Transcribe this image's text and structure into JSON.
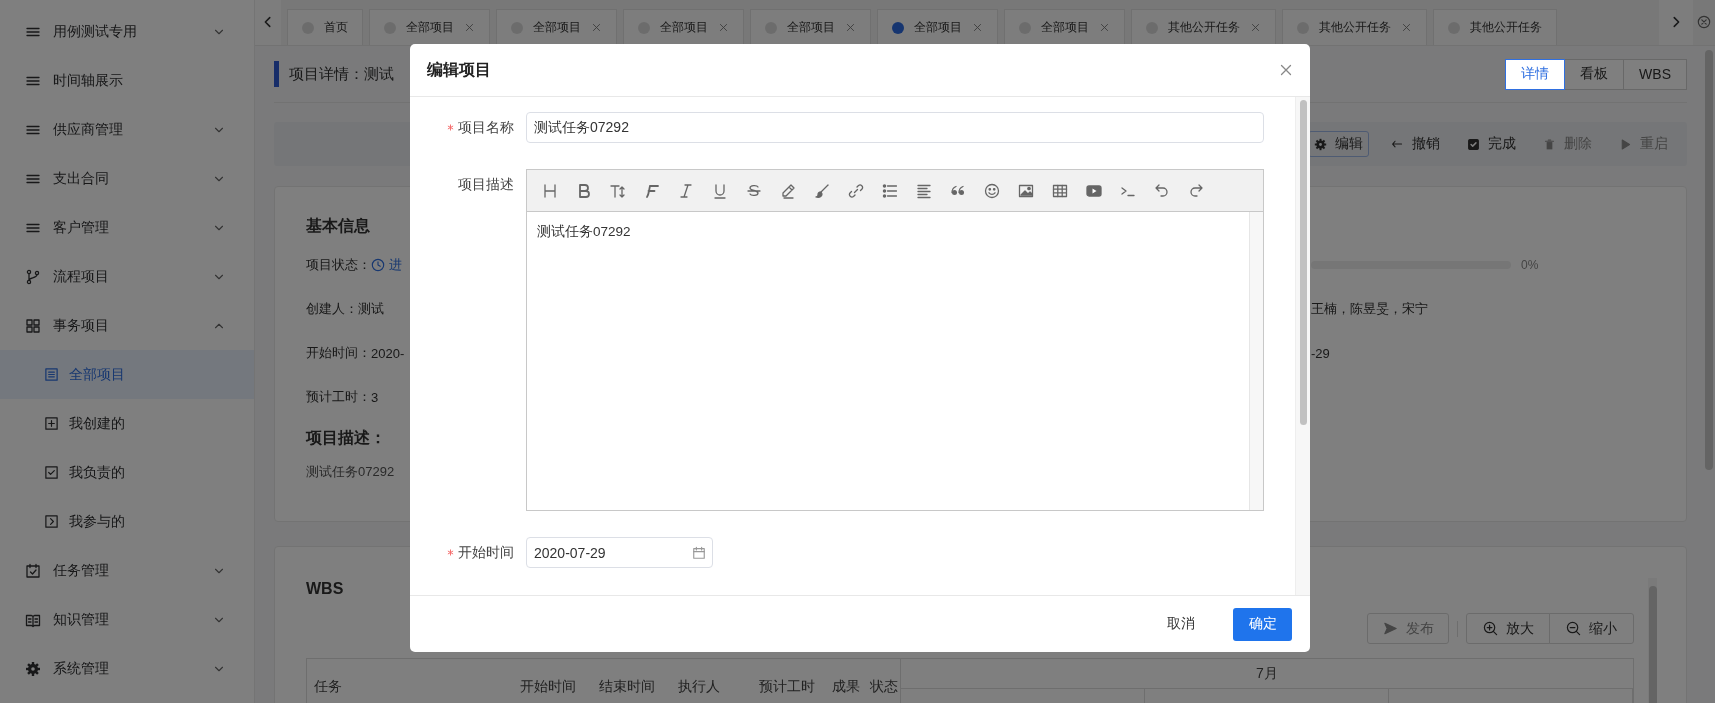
{
  "sidebar": {
    "items": [
      {
        "label": "用例测试专用",
        "kind": "group",
        "expanded": false,
        "selected": false
      },
      {
        "label": "时间轴展示",
        "kind": "link",
        "selected": false
      },
      {
        "label": "供应商管理",
        "kind": "group",
        "expanded": false,
        "selected": false
      },
      {
        "label": "支出合同",
        "kind": "group",
        "expanded": false,
        "selected": false
      },
      {
        "label": "客户管理",
        "kind": "group",
        "expanded": false,
        "selected": false
      },
      {
        "label": "流程项目",
        "kind": "group",
        "expanded": false,
        "selected": false
      },
      {
        "label": "事务项目",
        "kind": "group",
        "expanded": true,
        "selected": false,
        "children": [
          {
            "label": "全部项目",
            "selected": true
          },
          {
            "label": "我创建的",
            "selected": false
          },
          {
            "label": "我负责的",
            "selected": false
          },
          {
            "label": "我参与的",
            "selected": false
          }
        ]
      },
      {
        "label": "任务管理",
        "kind": "group",
        "expanded": false,
        "selected": false
      },
      {
        "label": "知识管理",
        "kind": "group",
        "expanded": false,
        "selected": false
      },
      {
        "label": "系统管理",
        "kind": "group",
        "expanded": false,
        "selected": false
      }
    ]
  },
  "tabs": [
    {
      "label": "首页",
      "selected": false,
      "closable": false
    },
    {
      "label": "全部项目",
      "selected": false,
      "closable": true
    },
    {
      "label": "全部项目",
      "selected": false,
      "closable": true
    },
    {
      "label": "全部项目",
      "selected": false,
      "closable": true
    },
    {
      "label": "全部项目",
      "selected": false,
      "closable": true
    },
    {
      "label": "全部项目",
      "selected": true,
      "closable": true
    },
    {
      "label": "全部项目",
      "selected": false,
      "closable": true
    },
    {
      "label": "其他公开任务",
      "selected": false,
      "closable": true
    },
    {
      "label": "其他公开任务",
      "selected": false,
      "closable": true
    },
    {
      "label": "其他公开任务",
      "selected": false,
      "closable": false
    }
  ],
  "page": {
    "title": "项目详情：测试",
    "view_tabs": [
      {
        "label": "详情",
        "selected": true
      },
      {
        "label": "看板",
        "selected": false
      },
      {
        "label": "WBS",
        "selected": false
      }
    ],
    "actions": [
      {
        "label": "编辑",
        "disabled": false
      },
      {
        "label": "撤销",
        "disabled": false
      },
      {
        "label": "完成",
        "disabled": false
      },
      {
        "label": "删除",
        "disabled": true
      },
      {
        "label": "重启",
        "disabled": true
      }
    ]
  },
  "basic_info": {
    "title": "基本信息",
    "fields": [
      {
        "kind": "status",
        "label": "项目状态：",
        "value": "进"
      },
      {
        "kind": "text",
        "label": "创建人：",
        "value": "测试"
      },
      {
        "kind": "text",
        "label": "开始时间：",
        "value": "2020-"
      },
      {
        "kind": "text",
        "label": "预计工时：",
        "value": "3"
      }
    ],
    "column_2": [
      {
        "kind": "progress",
        "level": 0,
        "reading": "0%"
      },
      {
        "kind": "text",
        "value": "王楠，陈昱旻，宋宁"
      },
      {
        "kind": "text",
        "value": "-29"
      }
    ],
    "description_title": "项目描述：",
    "description": "测试任务07292"
  },
  "wbs": {
    "title": "WBS",
    "actions": [
      {
        "label": "发布",
        "disabled": true
      },
      {
        "label": "放大",
        "disabled": false
      },
      {
        "label": "缩小",
        "disabled": false
      }
    ],
    "columns": [
      "任务",
      "开始时间",
      "结束时间",
      "执行人",
      "预计工时",
      "成果",
      "状态"
    ],
    "month": "7月"
  },
  "modal": {
    "title": "编辑项目",
    "fields": [
      {
        "kind": "text",
        "label": "项目名称",
        "required": true,
        "value": "测试任务07292"
      },
      {
        "kind": "editor",
        "label": "项目描述",
        "required": false,
        "value": "测试任务07292"
      },
      {
        "kind": "date",
        "label": "开始时间",
        "required": true,
        "value": "2020-07-29"
      }
    ],
    "buttons": [
      {
        "label": "取消",
        "kind": "default"
      },
      {
        "label": "确定",
        "kind": "primary"
      }
    ]
  }
}
